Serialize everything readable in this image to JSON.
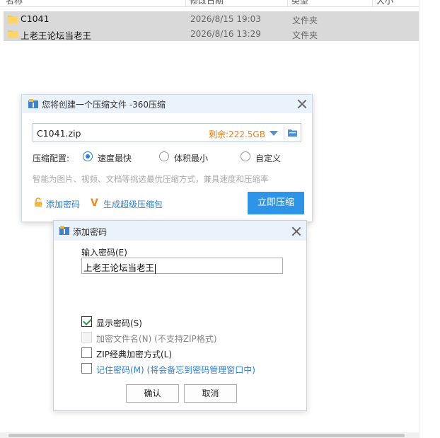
{
  "explorer": {
    "columns": [
      "名称",
      "修改日期",
      "类型",
      "大小"
    ],
    "rows": [
      {
        "name": "C1041",
        "date": "2026/8/15 19:03",
        "type": "文件夹"
      },
      {
        "name": "上老王论坛当老王",
        "date": "2026/8/16 13:29",
        "type": "文件夹"
      }
    ]
  },
  "zip_dialog": {
    "title": "您将创建一个压缩文件 -360压缩",
    "filename": "C1041.zip",
    "free_space": "剩余:222.5GB",
    "config_label": "压缩配置:",
    "options": [
      "速度最快",
      "体积最小",
      "自定义"
    ],
    "selected_option": "速度最快",
    "hint": "智能为图片、视频、文档等挑选最优压缩方式，兼具速度和压缩率",
    "add_password": "添加密码",
    "super_package": "生成超级压缩包",
    "compress_button": "立即压缩",
    "accent_color": "#2d94e8",
    "free_space_color": "#ef7d18"
  },
  "password_dialog": {
    "title": "添加密码",
    "input_label": "输入密码(E)",
    "input_value": "上老王论坛当老王",
    "options": [
      {
        "label": "显示密码(S)",
        "checked": true,
        "enabled": true
      },
      {
        "label": "加密文件名(N) (不支持ZIP格式)",
        "checked": false,
        "enabled": false
      },
      {
        "label": "ZIP经典加密方式(L)",
        "checked": false,
        "enabled": true
      },
      {
        "label": "记住密码(M) (将会备忘到密码管理窗口中)",
        "checked": false,
        "enabled": true
      }
    ],
    "ok_button": "确认",
    "cancel_button": "取消"
  }
}
